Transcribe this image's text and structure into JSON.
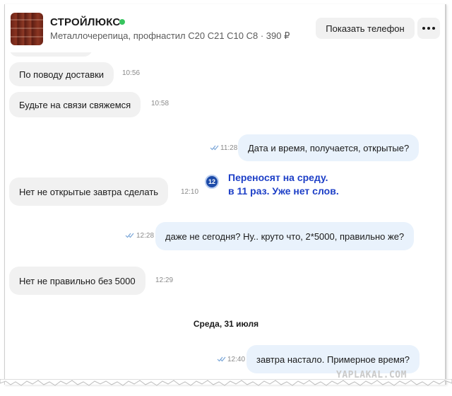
{
  "header": {
    "shop_name": "СТРОЙЛЮКС",
    "subtitle": "Металлочерепица, профнастил С20 С21 С10 С8 · 390 ₽",
    "phone_button": "Показать телефон",
    "online_color": "#37c45e",
    "more_icon": "more-dots-icon"
  },
  "messages": [
    {
      "dir": "in",
      "text": "По поводу доставки",
      "time": "10:56"
    },
    {
      "dir": "in",
      "text": "Будьте на связи свяжемся",
      "time": "10:58"
    },
    {
      "dir": "out",
      "text": "Дата и время, получается, открытые?",
      "time": "11:28"
    },
    {
      "dir": "in",
      "text": "Нет не открытые завтра сделать",
      "time": "12:10"
    },
    {
      "dir": "out",
      "text": "даже не сегодня? Ну.. круто что, 2*5000, правильно же?",
      "time": "12:28"
    },
    {
      "dir": "in",
      "text": "Нет не правильно без 5000",
      "time": "12:29"
    },
    {
      "dir": "out",
      "text": "завтра настало. Примерное время?",
      "time": "12:40"
    }
  ],
  "date_separator": "Среда, 31 июля",
  "annotation": {
    "badge": "12",
    "line1": "Переносят на среду.",
    "line2": "в 11 раз. Уже нет слов."
  },
  "watermark": "YAPLAKAL.COM",
  "colors": {
    "incoming_bubble": "#f1f1f1",
    "outgoing_bubble": "#e9f2fc",
    "read_checks": "#7aa6d8",
    "annotation": "#1d3fc7"
  }
}
